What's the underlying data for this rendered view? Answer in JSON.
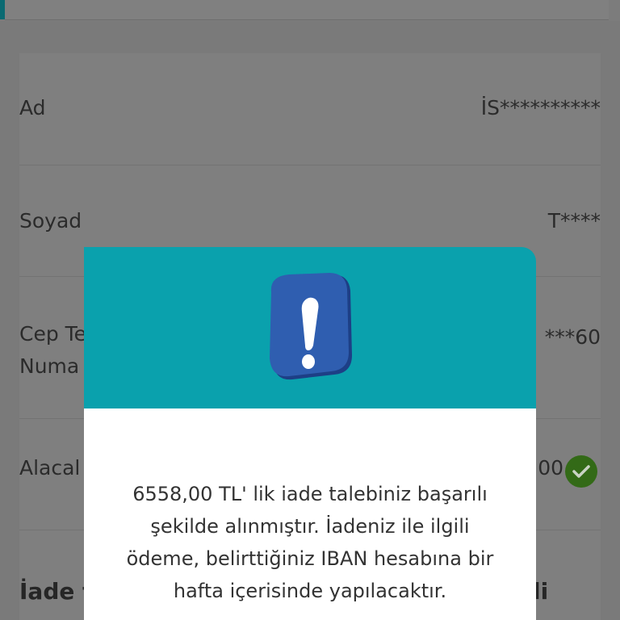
{
  "rows": [
    {
      "label": "Ad",
      "value": "İS**********"
    },
    {
      "label": "Soyad",
      "value": "T****"
    },
    {
      "label": "Cep Te",
      "label2": "Numa",
      "value": "***60"
    },
    {
      "label": "Alacal",
      "value": "00"
    }
  ],
  "bottom": {
    "left_text": "İade t",
    "right_text": "li"
  },
  "modal": {
    "icon": "alert-exclamation-icon",
    "message_lines": [
      "6558,00 TL' lik iade talebiniz başarılı",
      "şekilde alınmıştır. İadeniz ile ilgili",
      "ödeme, belirttiğiniz IBAN hesabına bir",
      "hafta içerisinde yapılacaktır."
    ]
  },
  "colors": {
    "modal_header": "#0aa1ad",
    "check_badge": "#336a17",
    "icon_blue": "#2f5eb0"
  }
}
